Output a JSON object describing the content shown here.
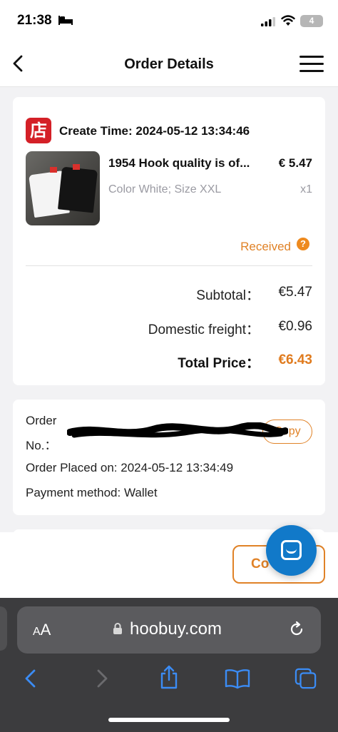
{
  "status_bar": {
    "time": "21:38",
    "battery": "4"
  },
  "header": {
    "title": "Order Details"
  },
  "order": {
    "shop_icon_glyph": "店",
    "create_time": "Create Time: 2024-05-12 13:34:46",
    "product": {
      "name": "1954 Hook quality is of...",
      "price": "€ 5.47",
      "variant": "Color White; Size XXL",
      "quantity": "x1"
    },
    "status": "Received",
    "help_glyph": "?",
    "subtotal_label": "Subtotal：",
    "subtotal_value": "€5.47",
    "freight_label": "Domestic freight：",
    "freight_value": "€0.96",
    "total_label": "Total Price：",
    "total_value": "€6.43"
  },
  "info": {
    "order_no_label_1": "Order",
    "order_no_label_2": "No.：",
    "copy_label": "Copy",
    "placed_on": "Order Placed on: 2024-05-12 13:34:49",
    "payment": "Payment method: Wallet"
  },
  "actions": {
    "confirm_label": "Co"
  },
  "browser": {
    "aa_small": "A",
    "aa_large": "A",
    "url": "hoobuy.com"
  },
  "colors": {
    "accent": "#e08227",
    "chat_blue": "#1179c9",
    "shop_red": "#d42027"
  },
  "icons": {
    "back": "chevron-left-icon",
    "menu": "hamburger-menu-icon",
    "chat": "chat-bubble-icon",
    "lock": "lock-icon",
    "reload": "reload-icon",
    "share": "share-icon",
    "bookmarks": "book-icon",
    "tabs": "tabs-icon"
  }
}
